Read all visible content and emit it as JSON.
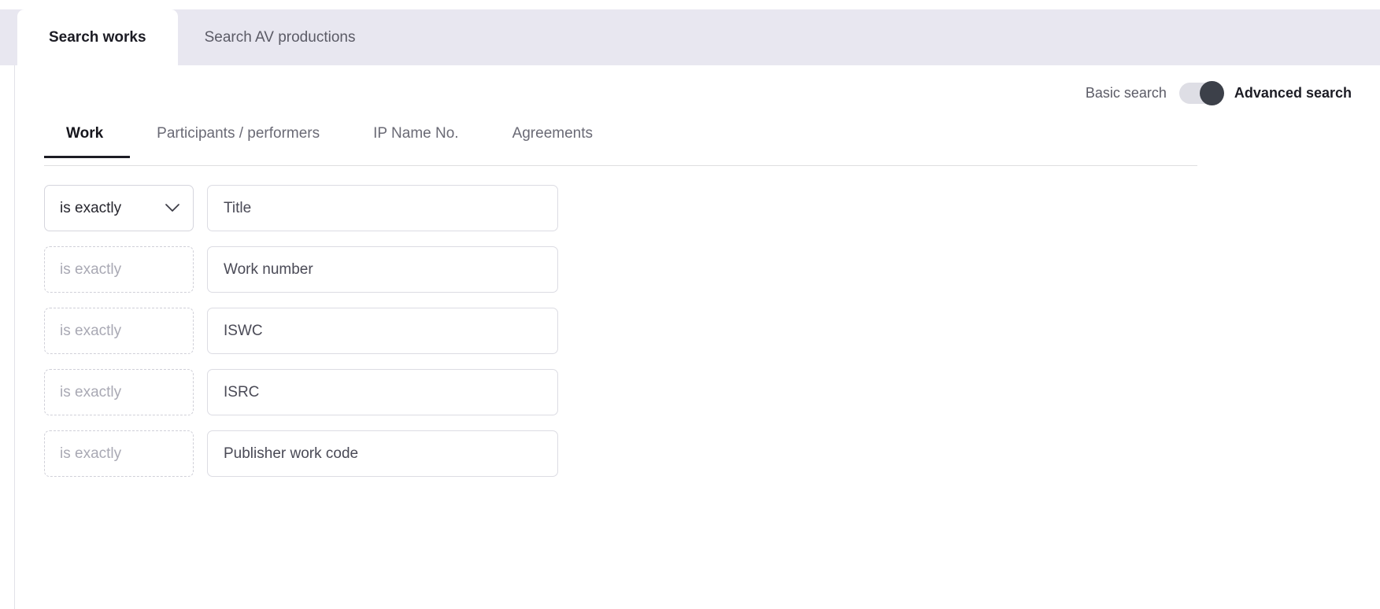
{
  "tabs": [
    {
      "label": "Search works",
      "active": true
    },
    {
      "label": "Search AV productions",
      "active": false
    }
  ],
  "search_mode": {
    "basic_label": "Basic search",
    "advanced_label": "Advanced search",
    "active": "Advanced search",
    "toggle_position": "right",
    "track_color": "#dedee5",
    "knob_color": "#3c4049"
  },
  "subtabs": [
    {
      "label": "Work",
      "active": true
    },
    {
      "label": "Participants / performers",
      "active": false
    },
    {
      "label": "IP Name No.",
      "active": false
    },
    {
      "label": "Agreements",
      "active": false
    }
  ],
  "form_rows": [
    {
      "operator": "is exactly",
      "operator_enabled": true,
      "chevron_icon": "chevron-down-icon",
      "field_placeholder": "Title",
      "field_value": ""
    },
    {
      "operator": "is exactly",
      "operator_enabled": false,
      "chevron_icon": "",
      "field_placeholder": "Work number",
      "field_value": ""
    },
    {
      "operator": "is exactly",
      "operator_enabled": false,
      "chevron_icon": "",
      "field_placeholder": "ISWC",
      "field_value": ""
    },
    {
      "operator": "is exactly",
      "operator_enabled": false,
      "chevron_icon": "",
      "field_placeholder": "ISRC",
      "field_value": ""
    },
    {
      "operator": "is exactly",
      "operator_enabled": false,
      "chevron_icon": "",
      "field_placeholder": "Publisher work code",
      "field_value": ""
    }
  ],
  "colors": {
    "tabstrip_bg": "#e8e7f0",
    "active_tab_bg": "#ffffff",
    "text_dark": "#1c1c24",
    "text_muted": "#6a6a75",
    "border": "#dcdce3"
  }
}
